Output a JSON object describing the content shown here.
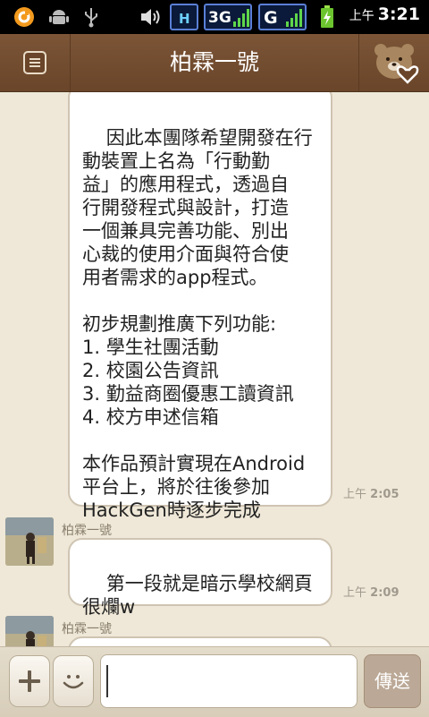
{
  "status_bar": {
    "ampm": "上午",
    "time": "3:21",
    "network_1": "H",
    "network_2": "3G",
    "network_3": "G"
  },
  "header": {
    "title": "柏霖一號"
  },
  "messages": [
    {
      "text": "因此本團隊希望開發在行\n動裝置上名為「行動勤\n益」的應用程式，透過自\n行開發程式與設計，打造\n一個兼具完善功能、別出\n心裁的使用介面與符合使\n用者需求的app程式。\n\n初步規劃推廣下列功能:\n1. 學生社團活動\n2. 校園公告資訊\n3. 勤益商圈優惠工讀資訊\n4. 校方申述信箱\n\n本作品預計實現在Android\n平台上，將於往後參加\nHackGen時逐步完成",
      "ampm": "上午",
      "time": "2:05"
    },
    {
      "sender": "柏霖一號",
      "text": "第一段就是暗示學校網頁\n很爛w",
      "ampm": "上午",
      "time": "2:09"
    },
    {
      "sender": "柏霖一號"
    }
  ],
  "input": {
    "value": "",
    "send_label": "傳送"
  },
  "colors": {
    "header": "#6a4529",
    "background": "#efe8d8",
    "bubble_border": "#cfc4b2",
    "send_button": "#bba896"
  },
  "icons": [
    "notification-icon",
    "android-debug-icon",
    "usb-icon",
    "volume-icon",
    "signal-icon",
    "battery-icon",
    "menu-icon",
    "bear-heart-icon",
    "plus-icon",
    "emoticon-icon"
  ]
}
